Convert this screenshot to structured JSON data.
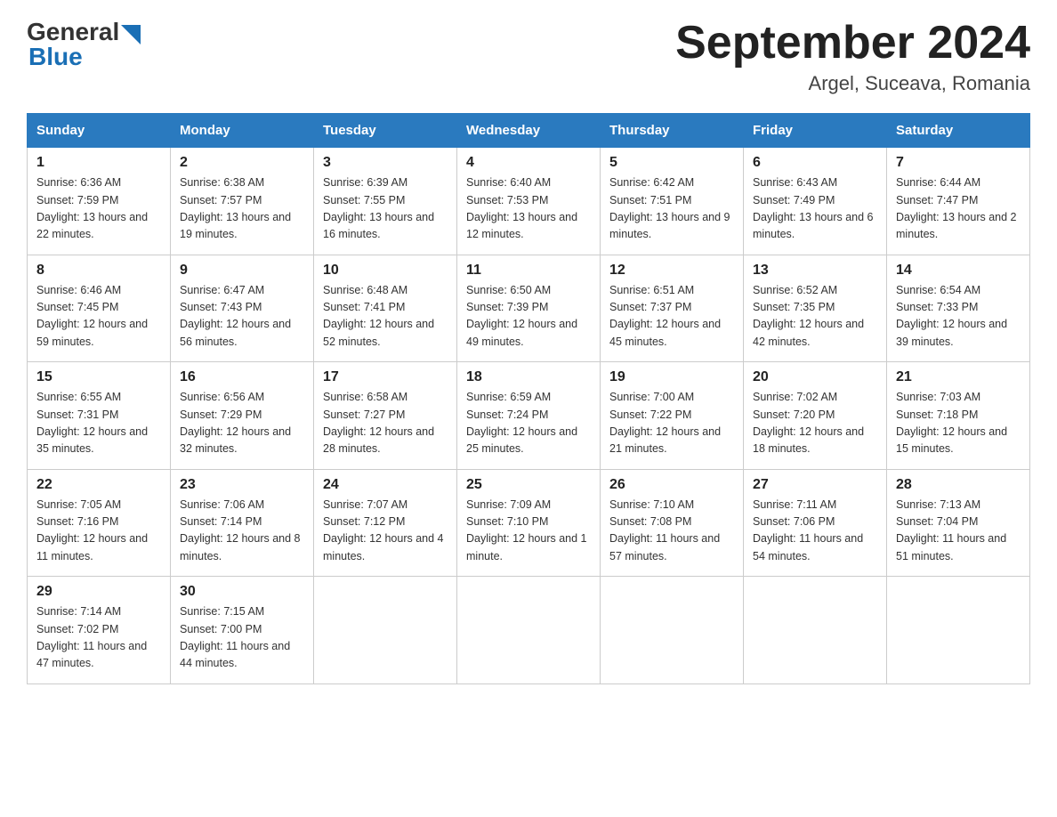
{
  "header": {
    "logo_general": "General",
    "logo_blue": "Blue",
    "title": "September 2024",
    "location": "Argel, Suceava, Romania"
  },
  "days_of_week": [
    "Sunday",
    "Monday",
    "Tuesday",
    "Wednesday",
    "Thursday",
    "Friday",
    "Saturday"
  ],
  "weeks": [
    [
      {
        "day": "1",
        "sunrise": "6:36 AM",
        "sunset": "7:59 PM",
        "daylight": "13 hours and 22 minutes."
      },
      {
        "day": "2",
        "sunrise": "6:38 AM",
        "sunset": "7:57 PM",
        "daylight": "13 hours and 19 minutes."
      },
      {
        "day": "3",
        "sunrise": "6:39 AM",
        "sunset": "7:55 PM",
        "daylight": "13 hours and 16 minutes."
      },
      {
        "day": "4",
        "sunrise": "6:40 AM",
        "sunset": "7:53 PM",
        "daylight": "13 hours and 12 minutes."
      },
      {
        "day": "5",
        "sunrise": "6:42 AM",
        "sunset": "7:51 PM",
        "daylight": "13 hours and 9 minutes."
      },
      {
        "day": "6",
        "sunrise": "6:43 AM",
        "sunset": "7:49 PM",
        "daylight": "13 hours and 6 minutes."
      },
      {
        "day": "7",
        "sunrise": "6:44 AM",
        "sunset": "7:47 PM",
        "daylight": "13 hours and 2 minutes."
      }
    ],
    [
      {
        "day": "8",
        "sunrise": "6:46 AM",
        "sunset": "7:45 PM",
        "daylight": "12 hours and 59 minutes."
      },
      {
        "day": "9",
        "sunrise": "6:47 AM",
        "sunset": "7:43 PM",
        "daylight": "12 hours and 56 minutes."
      },
      {
        "day": "10",
        "sunrise": "6:48 AM",
        "sunset": "7:41 PM",
        "daylight": "12 hours and 52 minutes."
      },
      {
        "day": "11",
        "sunrise": "6:50 AM",
        "sunset": "7:39 PM",
        "daylight": "12 hours and 49 minutes."
      },
      {
        "day": "12",
        "sunrise": "6:51 AM",
        "sunset": "7:37 PM",
        "daylight": "12 hours and 45 minutes."
      },
      {
        "day": "13",
        "sunrise": "6:52 AM",
        "sunset": "7:35 PM",
        "daylight": "12 hours and 42 minutes."
      },
      {
        "day": "14",
        "sunrise": "6:54 AM",
        "sunset": "7:33 PM",
        "daylight": "12 hours and 39 minutes."
      }
    ],
    [
      {
        "day": "15",
        "sunrise": "6:55 AM",
        "sunset": "7:31 PM",
        "daylight": "12 hours and 35 minutes."
      },
      {
        "day": "16",
        "sunrise": "6:56 AM",
        "sunset": "7:29 PM",
        "daylight": "12 hours and 32 minutes."
      },
      {
        "day": "17",
        "sunrise": "6:58 AM",
        "sunset": "7:27 PM",
        "daylight": "12 hours and 28 minutes."
      },
      {
        "day": "18",
        "sunrise": "6:59 AM",
        "sunset": "7:24 PM",
        "daylight": "12 hours and 25 minutes."
      },
      {
        "day": "19",
        "sunrise": "7:00 AM",
        "sunset": "7:22 PM",
        "daylight": "12 hours and 21 minutes."
      },
      {
        "day": "20",
        "sunrise": "7:02 AM",
        "sunset": "7:20 PM",
        "daylight": "12 hours and 18 minutes."
      },
      {
        "day": "21",
        "sunrise": "7:03 AM",
        "sunset": "7:18 PM",
        "daylight": "12 hours and 15 minutes."
      }
    ],
    [
      {
        "day": "22",
        "sunrise": "7:05 AM",
        "sunset": "7:16 PM",
        "daylight": "12 hours and 11 minutes."
      },
      {
        "day": "23",
        "sunrise": "7:06 AM",
        "sunset": "7:14 PM",
        "daylight": "12 hours and 8 minutes."
      },
      {
        "day": "24",
        "sunrise": "7:07 AM",
        "sunset": "7:12 PM",
        "daylight": "12 hours and 4 minutes."
      },
      {
        "day": "25",
        "sunrise": "7:09 AM",
        "sunset": "7:10 PM",
        "daylight": "12 hours and 1 minute."
      },
      {
        "day": "26",
        "sunrise": "7:10 AM",
        "sunset": "7:08 PM",
        "daylight": "11 hours and 57 minutes."
      },
      {
        "day": "27",
        "sunrise": "7:11 AM",
        "sunset": "7:06 PM",
        "daylight": "11 hours and 54 minutes."
      },
      {
        "day": "28",
        "sunrise": "7:13 AM",
        "sunset": "7:04 PM",
        "daylight": "11 hours and 51 minutes."
      }
    ],
    [
      {
        "day": "29",
        "sunrise": "7:14 AM",
        "sunset": "7:02 PM",
        "daylight": "11 hours and 47 minutes."
      },
      {
        "day": "30",
        "sunrise": "7:15 AM",
        "sunset": "7:00 PM",
        "daylight": "11 hours and 44 minutes."
      },
      null,
      null,
      null,
      null,
      null
    ]
  ]
}
